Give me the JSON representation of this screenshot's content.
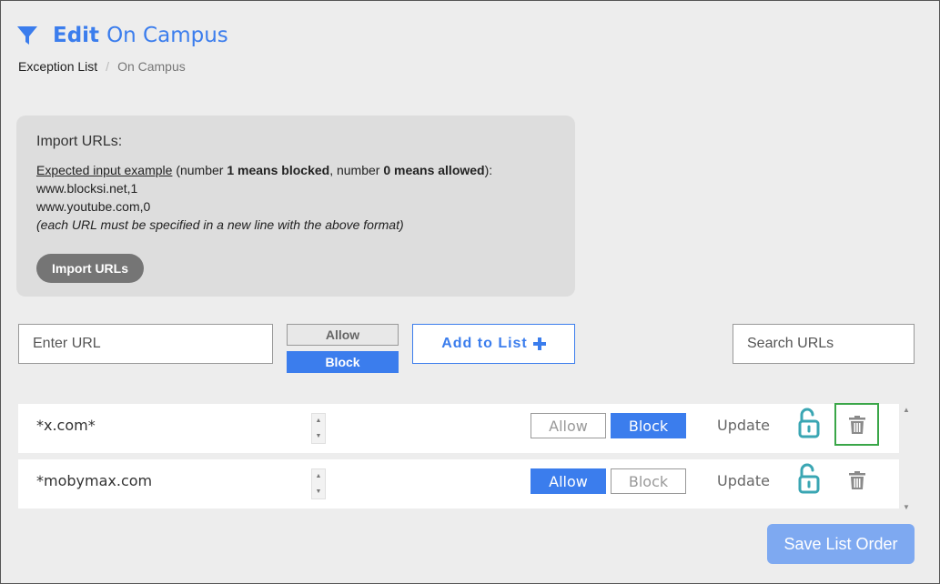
{
  "header": {
    "title_prefix": "Edit",
    "title_name": "On Campus"
  },
  "breadcrumb": {
    "link": "Exception List",
    "separator": "/",
    "current": "On Campus"
  },
  "import_panel": {
    "title": "Import URLs:",
    "example_link": "Expected input example",
    "example_pre": " (number ",
    "blocked_bold": "1 means blocked",
    "example_mid": ", number ",
    "allowed_bold": "0 means allowed",
    "example_post": "):",
    "sample_1": "www.blocksi.net,1",
    "sample_2": "www.youtube.com,0",
    "note": "(each URL must be specified in a new line with the above format)",
    "button_label": "Import URLs"
  },
  "entry": {
    "url_placeholder": "Enter URL",
    "allow_label": "Allow",
    "block_label": "Block",
    "selected_mode": "Block",
    "add_label": "Add to List",
    "add_icon": "plus-icon",
    "search_placeholder": "Search URLs"
  },
  "list": {
    "rows": [
      {
        "url": "*x.com*",
        "allow_label": "Allow",
        "block_label": "Block",
        "selected": "Block",
        "update_label": "Update"
      },
      {
        "url": "*mobymax.com",
        "allow_label": "Allow",
        "block_label": "Block",
        "selected": "Allow",
        "update_label": "Update"
      }
    ]
  },
  "footer": {
    "save_order_label": "Save List Order"
  },
  "colors": {
    "accent": "#3b7ded",
    "lock": "#3aa6b3",
    "focus": "#3aa648",
    "save_disabled": "#7ea9f1"
  }
}
